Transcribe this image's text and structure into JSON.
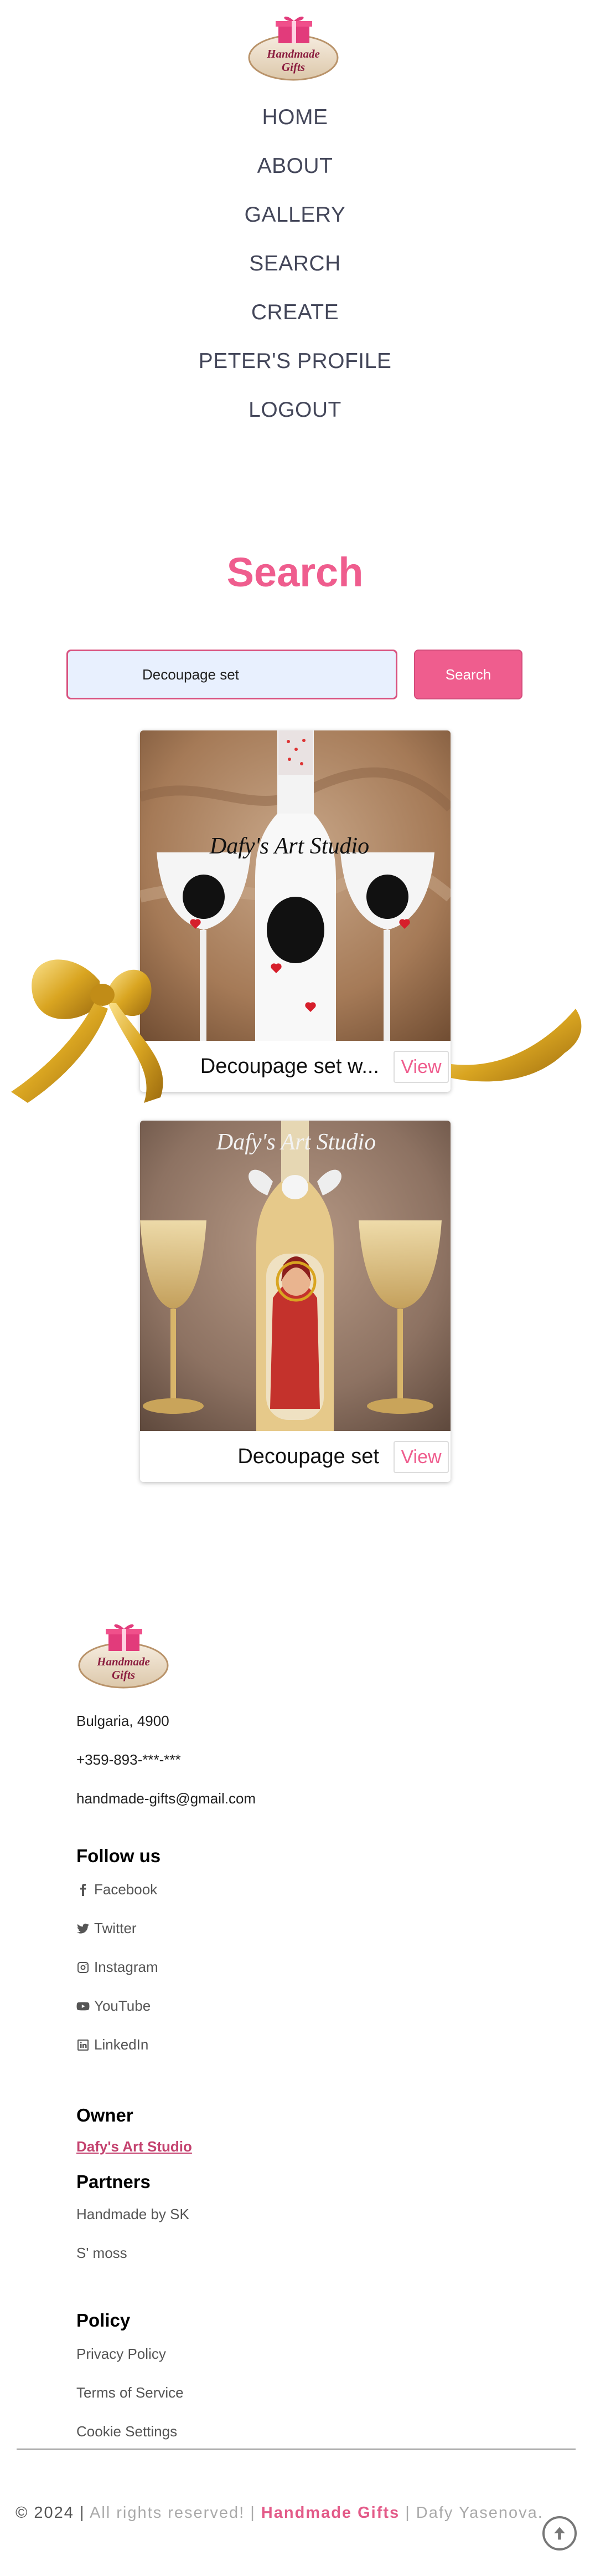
{
  "brand": {
    "logo_line1": "Handmade",
    "logo_line2": "Gifts"
  },
  "nav": {
    "home": "HOME",
    "about": "ABOUT",
    "gallery": "GALLERY",
    "search": "SEARCH",
    "create": "CREATE",
    "profile": "PETER'S PROFILE",
    "logout": "LOGOUT"
  },
  "search": {
    "title": "Search",
    "query": "Decoupage set",
    "button_label": "Search"
  },
  "results": [
    {
      "title": "Decoupage set w...",
      "view_label": "View",
      "watermark": "Dafy's Art Studio"
    },
    {
      "title": "Decoupage set",
      "view_label": "View",
      "watermark": "Dafy's Art Studio"
    }
  ],
  "footer": {
    "address": "Bulgaria, 4900",
    "phone": "+359-893-***-***",
    "email": "handmade-gifts@gmail.com",
    "follow_heading": "Follow us",
    "social": [
      "Facebook",
      "Twitter",
      "Instagram",
      "YouTube",
      "LinkedIn"
    ],
    "owner_heading": "Owner",
    "owner_name": "Dafy's Art Studio",
    "partners_heading": "Partners",
    "partners": [
      "Handmade by SK",
      "S' moss"
    ],
    "policy_heading": "Policy",
    "policy_links": [
      "Privacy Policy",
      "Terms of Service",
      "Cookie Settings"
    ],
    "copyright_prefix": "© 2024 |",
    "copyright_rights": " All rights reserved! | ",
    "copyright_brand": "Handmade Gifts",
    "copyright_author": " | Dafy Yasenova."
  },
  "colors": {
    "accent": "#ef5d8e",
    "nav_text": "#44475a",
    "input_bg": "#e8f0fe"
  },
  "icons": [
    "facebook-icon",
    "twitter-icon",
    "instagram-icon",
    "youtube-icon",
    "linkedin-icon",
    "arrow-up-icon",
    "gift-icon"
  ]
}
